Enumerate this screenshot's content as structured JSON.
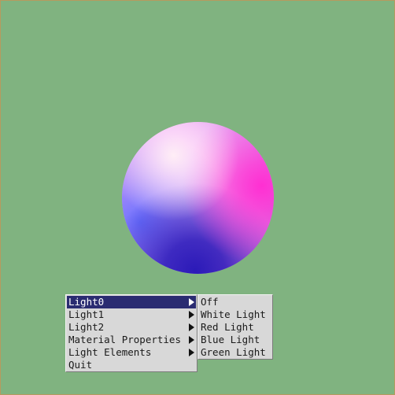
{
  "background_color": "#80b380",
  "sphere_colors": {
    "highlight": "#ffeef6",
    "upper_left": "#ffc8f4",
    "right": "#ff2fd2",
    "bottom": "#2b1ab8",
    "lower_left": "#6a72ff"
  },
  "menu": {
    "items": [
      {
        "label": "Light0",
        "has_submenu": true,
        "active": true
      },
      {
        "label": "Light1",
        "has_submenu": true,
        "active": false
      },
      {
        "label": "Light2",
        "has_submenu": true,
        "active": false
      },
      {
        "label": "Material Properties",
        "has_submenu": true,
        "active": false
      },
      {
        "label": "Light Elements",
        "has_submenu": true,
        "active": false
      },
      {
        "label": "Quit",
        "has_submenu": false,
        "active": false
      }
    ],
    "submenu": {
      "items": [
        "Off",
        "White Light",
        "Red Light",
        "Blue Light",
        "Green Light"
      ]
    },
    "highlight_color": "#2a2c71"
  }
}
